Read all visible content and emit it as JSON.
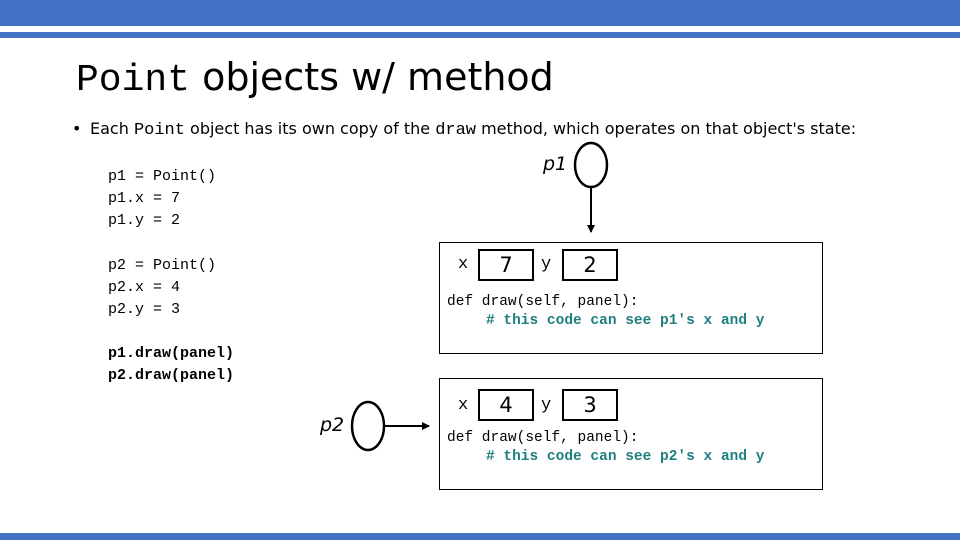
{
  "slide": {
    "title": {
      "code_part": "Point",
      "text_part": " objects w/ method"
    },
    "bullet": {
      "marker": "•",
      "pre": "Each ",
      "code1": "Point",
      "mid": " object has its own copy of the ",
      "code2": "draw",
      "post": " method, which operates on that object's state:"
    },
    "code": {
      "block1": [
        "p1 = Point()",
        "p1.x = 7",
        "p1.y = 2"
      ],
      "block2": [
        "p2 = Point()",
        "p2.x = 4",
        "p2.y = 3"
      ],
      "block3": [
        "p1.draw(panel)",
        "p2.draw(panel)"
      ]
    },
    "objects": [
      {
        "label": "p1",
        "x_label": "x",
        "x_value": "7",
        "y_label": "y",
        "y_value": "2",
        "method": "def draw(self, panel):",
        "comment": "# this code can see p1's x and y"
      },
      {
        "label": "p2",
        "x_label": "x",
        "x_value": "4",
        "y_label": "y",
        "y_value": "3",
        "method": "def draw(self, panel):",
        "comment": "# this code can see p2's x and y"
      }
    ],
    "colors": {
      "accent_bar": "#4472c4",
      "comment": "#1f7f7f"
    }
  }
}
